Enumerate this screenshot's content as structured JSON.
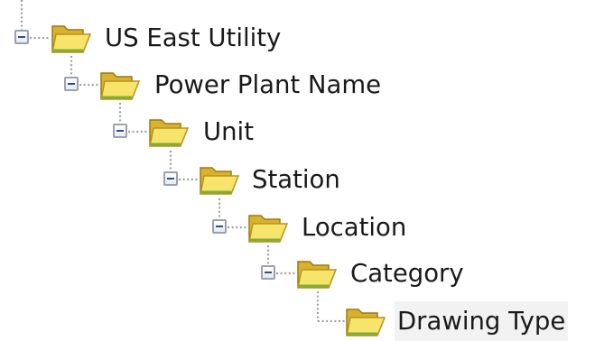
{
  "tree": {
    "nodes": [
      {
        "label": "US East Utility",
        "expanded": true,
        "has_toggle": true
      },
      {
        "label": "Power Plant Name",
        "expanded": true,
        "has_toggle": true
      },
      {
        "label": "Unit",
        "expanded": true,
        "has_toggle": true
      },
      {
        "label": "Station",
        "expanded": true,
        "has_toggle": true
      },
      {
        "label": "Location",
        "expanded": true,
        "has_toggle": true
      },
      {
        "label": "Category",
        "expanded": true,
        "has_toggle": true
      },
      {
        "label": "Drawing Type",
        "expanded": false,
        "has_toggle": false,
        "selected": true
      }
    ],
    "icons": {
      "expanded_toggle": "collapse-minus-icon",
      "node": "open-folder-icon"
    },
    "colors": {
      "folder_back": "#d8b22e",
      "folder_front": "#f7e46a",
      "folder_accent": "#7fae3a",
      "connector": "#a0a0a0",
      "toggle_border": "#9aa3ad",
      "toggle_sign": "#2f4f8f",
      "selected_background": "#f2f2f2"
    }
  }
}
